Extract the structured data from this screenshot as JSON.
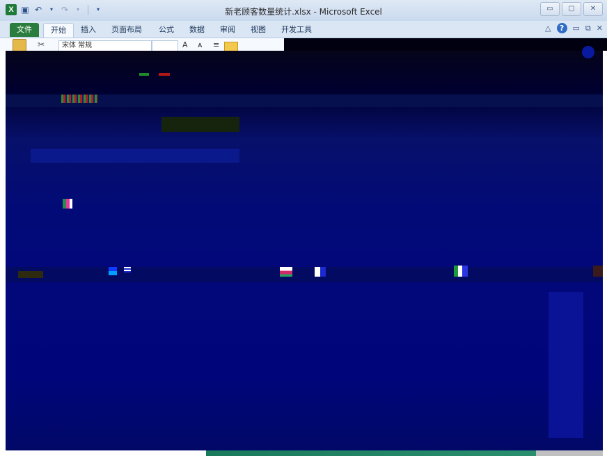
{
  "window": {
    "title": "新老顾客数量统计.xlsx - Microsoft Excel",
    "app_logo": "X",
    "controls": {
      "minimize": "▭",
      "maximize": "▢",
      "close": "✕"
    }
  },
  "quick_access": {
    "icons": [
      "save-icon",
      "undo-icon",
      "redo-icon",
      "customize-icon"
    ]
  },
  "ribbon_tabs": [
    {
      "label": "文件",
      "kind": "file"
    },
    {
      "label": "开始",
      "kind": "active"
    },
    {
      "label": "插入",
      "kind": "normal"
    },
    {
      "label": "页面布局",
      "kind": "normal"
    },
    {
      "label": "公式",
      "kind": "normal"
    },
    {
      "label": "数据",
      "kind": "normal"
    },
    {
      "label": "审阅",
      "kind": "normal"
    },
    {
      "label": "视图",
      "kind": "normal"
    },
    {
      "label": "开发工具",
      "kind": "normal"
    }
  ],
  "ribbon_right": {
    "help": "?"
  },
  "ribbon_body": {
    "font_name": "宋体 常规"
  },
  "colors": {
    "file_tab": "#2b7d3f",
    "dark_region": "#02077a"
  }
}
